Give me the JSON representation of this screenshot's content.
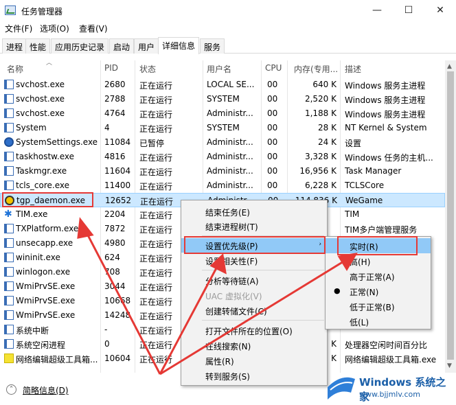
{
  "window": {
    "title": "任务管理器",
    "btn_minimize": "—",
    "btn_maximize": "☐",
    "btn_close": "✕"
  },
  "menu": {
    "file": "文件(F)",
    "options": "选项(O)",
    "view": "查看(V)"
  },
  "tabs": [
    "进程",
    "性能",
    "应用历史记录",
    "启动",
    "用户",
    "详细信息",
    "服务"
  ],
  "active_tab": "详细信息",
  "columns": {
    "name": "名称",
    "pid": "PID",
    "status": "状态",
    "user": "用户名",
    "cpu": "CPU",
    "memory": "内存(专用...",
    "desc": "描述"
  },
  "rows": [
    {
      "icon": "service-icon",
      "name": "svchost.exe",
      "pid": "2680",
      "status": "正在运行",
      "user": "LOCAL SE...",
      "cpu": "00",
      "mem": "640 K",
      "desc": "Windows 服务主进程"
    },
    {
      "icon": "service-icon",
      "name": "svchost.exe",
      "pid": "2788",
      "status": "正在运行",
      "user": "SYSTEM",
      "cpu": "00",
      "mem": "2,520 K",
      "desc": "Windows 服务主进程"
    },
    {
      "icon": "service-icon",
      "name": "svchost.exe",
      "pid": "4764",
      "status": "正在运行",
      "user": "Administr...",
      "cpu": "00",
      "mem": "1,188 K",
      "desc": "Windows 服务主进程"
    },
    {
      "icon": "service-icon",
      "name": "System",
      "pid": "4",
      "status": "正在运行",
      "user": "SYSTEM",
      "cpu": "00",
      "mem": "28 K",
      "desc": "NT Kernel & System"
    },
    {
      "icon": "gear-icon",
      "name": "SystemSettings.exe",
      "pid": "11084",
      "status": "已暂停",
      "user": "Administr...",
      "cpu": "00",
      "mem": "24 K",
      "desc": "设置"
    },
    {
      "icon": "service-icon",
      "name": "taskhostw.exe",
      "pid": "4816",
      "status": "正在运行",
      "user": "Administr...",
      "cpu": "00",
      "mem": "3,328 K",
      "desc": "Windows 任务的主机..."
    },
    {
      "icon": "taskmgr-icon",
      "name": "Taskmgr.exe",
      "pid": "11604",
      "status": "正在运行",
      "user": "Administr...",
      "cpu": "00",
      "mem": "16,956 K",
      "desc": "Task Manager"
    },
    {
      "icon": "window-icon",
      "name": "tcls_core.exe",
      "pid": "11400",
      "status": "正在运行",
      "user": "Administr...",
      "cpu": "00",
      "mem": "6,228 K",
      "desc": "TCLSCore"
    },
    {
      "icon": "wegame-icon",
      "name": "tgp_daemon.exe",
      "pid": "12652",
      "status": "正在运行",
      "user": "Administr...",
      "cpu": "00",
      "mem": "114,836 K",
      "desc": "WeGame"
    },
    {
      "icon": "star-icon",
      "name": "TIM.exe",
      "pid": "2204",
      "status": "正在运行",
      "user": "",
      "cpu": "",
      "mem": "",
      "desc": "TIM"
    },
    {
      "icon": "window-icon",
      "name": "TXPlatform.exe",
      "pid": "7872",
      "status": "正在运行",
      "user": "",
      "cpu": "",
      "mem": "",
      "desc": "TIM多户端管理服务"
    },
    {
      "icon": "window-icon",
      "name": "unsecapp.exe",
      "pid": "4980",
      "status": "正在运行",
      "user": "",
      "cpu": "",
      "mem": "",
      "desc": ""
    },
    {
      "icon": "window-icon",
      "name": "wininit.exe",
      "pid": "624",
      "status": "正在运行",
      "user": "",
      "cpu": "",
      "mem": "",
      "desc": ""
    },
    {
      "icon": "window-icon",
      "name": "winlogon.exe",
      "pid": "708",
      "status": "正在运行",
      "user": "",
      "cpu": "",
      "mem": "",
      "desc": ""
    },
    {
      "icon": "service-icon",
      "name": "WmiPrvSE.exe",
      "pid": "3044",
      "status": "正在运行",
      "user": "",
      "cpu": "",
      "mem": "",
      "desc": ""
    },
    {
      "icon": "service-icon",
      "name": "WmiPrvSE.exe",
      "pid": "10668",
      "status": "正在运行",
      "user": "",
      "cpu": "",
      "mem": "",
      "desc": ""
    },
    {
      "icon": "service-icon",
      "name": "WmiPrvSE.exe",
      "pid": "14248",
      "status": "正在运行",
      "user": "",
      "cpu": "",
      "mem": "",
      "desc": ""
    },
    {
      "icon": "window-icon",
      "name": "系统中断",
      "pid": "-",
      "status": "正在运行",
      "user": "",
      "cpu": "",
      "mem": "",
      "desc": ""
    },
    {
      "icon": "window-icon",
      "name": "系统空闲进程",
      "pid": "0",
      "status": "正在运行",
      "user": "",
      "cpu": "",
      "mem": "K",
      "desc": "处理器空闲时间百分比"
    },
    {
      "icon": "yellow-icon",
      "name": "网络编辑超级工具箱...",
      "pid": "10604",
      "status": "正在运行",
      "user": "",
      "cpu": "",
      "mem": "K",
      "desc": "网络编辑超级工具箱.exe"
    }
  ],
  "selected_row": 8,
  "context_menu": {
    "items": [
      "结束任务(E)",
      "结束进程树(T)",
      "设置优先级(P)",
      "设置相关性(F)",
      "分析等待链(A)",
      "UAC 虚拟化(V)",
      "创建转储文件(C)",
      "打开文件所在的位置(O)",
      "在线搜索(N)",
      "属性(R)",
      "转到服务(S)"
    ],
    "disabled": [
      "UAC 虚拟化(V)"
    ],
    "highlighted": "设置优先级(P)",
    "submenu_arrow": "›"
  },
  "priority_submenu": {
    "items": [
      "实时(R)",
      "高(H)",
      "高于正常(A)",
      "正常(N)",
      "低于正常(B)",
      "低(L)"
    ],
    "checked": "正常(N)",
    "highlighted": "实时(R)",
    "bullet": "●"
  },
  "footer": {
    "label": "简略信息(D)",
    "arrow": "⌃"
  },
  "watermark": {
    "line1": "Windows 系统之家",
    "line2": "www.bjjmlv.com"
  },
  "colors": {
    "selected_row": "#cce8ff",
    "menu_highlight": "#91c9f7",
    "annotation_red": "#e53935",
    "watermark_blue": "#1b5fa8"
  }
}
